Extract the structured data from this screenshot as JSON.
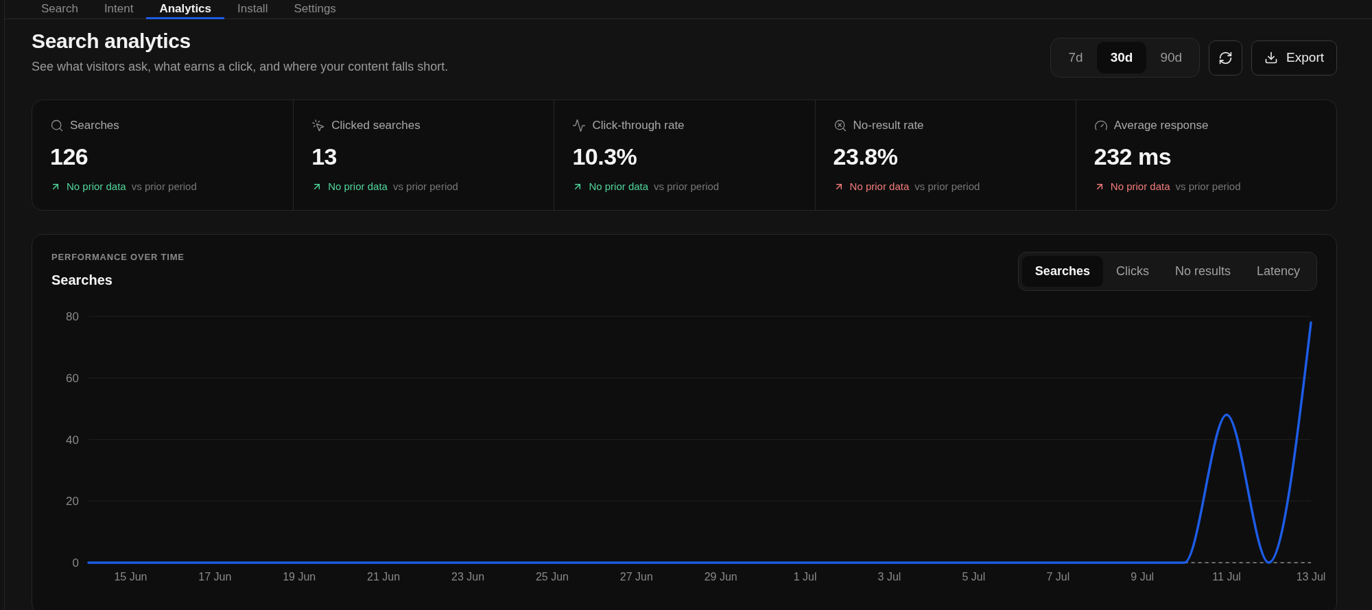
{
  "tabs": [
    {
      "label": "Search",
      "selected": false
    },
    {
      "label": "Intent",
      "selected": false
    },
    {
      "label": "Analytics",
      "selected": true
    },
    {
      "label": "Install",
      "selected": false
    },
    {
      "label": "Settings",
      "selected": false
    }
  ],
  "header": {
    "title": "Search analytics",
    "subtitle": "See what visitors ask, what earns a click, and where your content falls short."
  },
  "range_options": [
    {
      "label": "7d",
      "selected": false
    },
    {
      "label": "30d",
      "selected": true
    },
    {
      "label": "90d",
      "selected": false
    }
  ],
  "export_button": {
    "label": "Export"
  },
  "stats": [
    {
      "kind": "searches",
      "label": "Searches",
      "value": "126",
      "color": "#4fd49b",
      "change": "No prior data",
      "comparison": "vs prior period"
    },
    {
      "kind": "clicks",
      "label": "Clicked searches",
      "value": "13",
      "color": "#4fd49b",
      "change": "No prior data",
      "comparison": "vs prior period"
    },
    {
      "kind": "rate",
      "label": "Click-through rate",
      "value": "10.3%",
      "color": "#4fd49b",
      "change": "No prior data",
      "comparison": "vs prior period"
    },
    {
      "kind": "no_results",
      "label": "No-result rate",
      "value": "23.8%",
      "color": "#f27b7b",
      "change": "No prior data",
      "comparison": "vs prior period"
    },
    {
      "kind": "latency",
      "label": "Average response",
      "value": "232 ms",
      "color": "#f27b7b",
      "change": "No prior data",
      "comparison": "vs prior period"
    }
  ],
  "chart_panel": {
    "eyebrow": "PERFORMANCE OVER TIME",
    "title": "Searches",
    "metric_tabs": [
      {
        "label": "Searches",
        "selected": true
      },
      {
        "label": "Clicks",
        "selected": false
      },
      {
        "label": "No results",
        "selected": false
      },
      {
        "label": "Latency",
        "selected": false
      }
    ],
    "chart_data": {
      "type": "line",
      "categories": [
        null,
        "15 Jun",
        null,
        "17 Jun",
        null,
        "19 Jun",
        null,
        "21 Jun",
        null,
        "23 Jun",
        null,
        "25 Jun",
        null,
        "27 Jun",
        null,
        "29 Jun",
        null,
        "1 Jul",
        null,
        "3 Jul",
        null,
        "5 Jul",
        null,
        "7 Jul",
        null,
        "9 Jul",
        null,
        "11 Jul",
        null,
        "13 Jul"
      ],
      "series": [
        {
          "color": "#1d5ce6",
          "line_style": "solid",
          "values": [
            0,
            0,
            0,
            0,
            0,
            0,
            0,
            0,
            0,
            0,
            0,
            0,
            0,
            0,
            0,
            0,
            0,
            0,
            0,
            0,
            0,
            0,
            0,
            0,
            0,
            0,
            0,
            48,
            0,
            78
          ]
        },
        {
          "color": "#707070",
          "line_style": "dashed",
          "values": [
            null,
            null,
            null,
            null,
            null,
            null,
            null,
            null,
            null,
            null,
            null,
            null,
            null,
            null,
            null,
            null,
            null,
            null,
            null,
            null,
            null,
            null,
            null,
            null,
            null,
            null,
            0,
            0,
            0,
            0
          ]
        }
      ],
      "ylim": [
        0,
        80
      ],
      "grid": true,
      "yticks": [
        0,
        20,
        40,
        60,
        80
      ]
    }
  }
}
